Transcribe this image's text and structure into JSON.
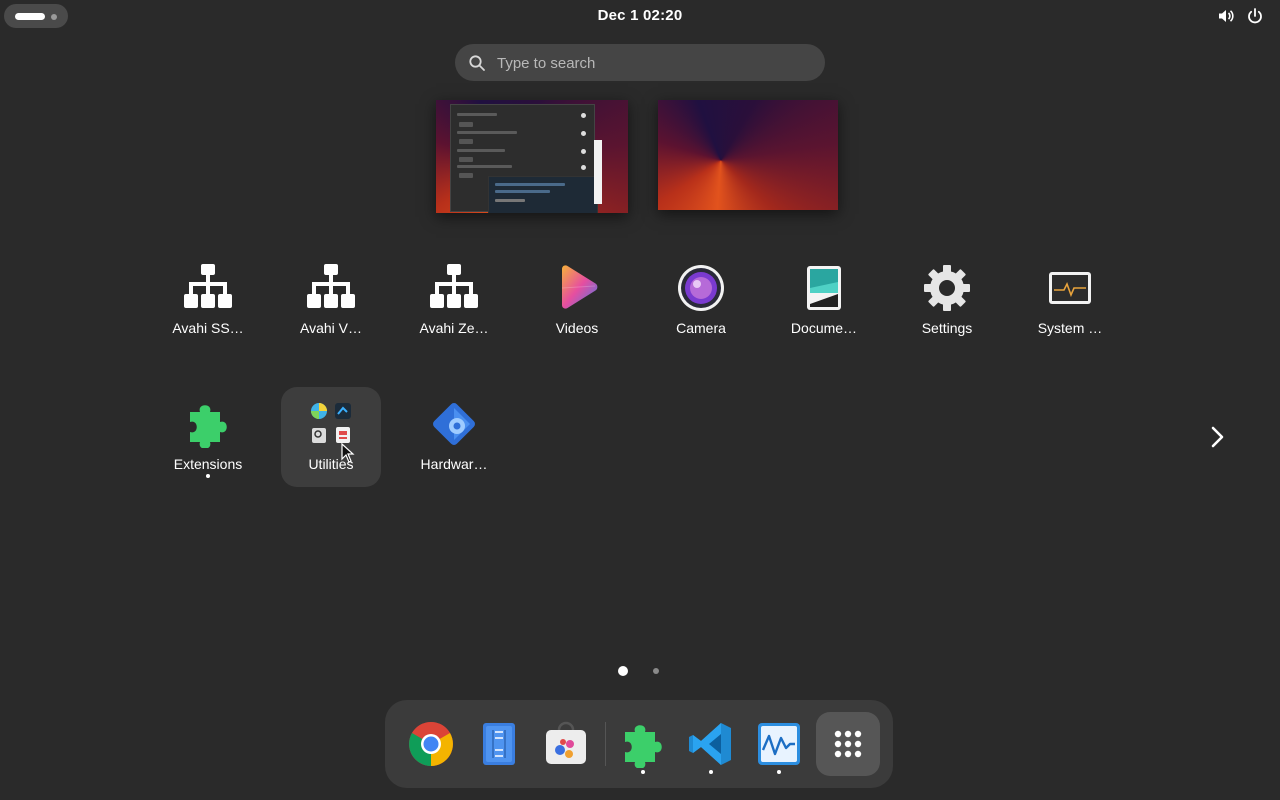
{
  "topbar": {
    "clock": "Dec 1  02:20",
    "activities": "activities-indicator",
    "icons": [
      "volume-icon",
      "power-icon"
    ]
  },
  "search": {
    "placeholder": "Type to search"
  },
  "workspaces": [
    "workspace-1",
    "workspace-2"
  ],
  "apps": {
    "row1": [
      {
        "label": "Avahi SS…",
        "icon": "network-icon"
      },
      {
        "label": "Avahi V…",
        "icon": "network-icon"
      },
      {
        "label": "Avahi Ze…",
        "icon": "network-icon"
      },
      {
        "label": "Videos",
        "icon": "videos-icon"
      },
      {
        "label": "Camera",
        "icon": "camera-icon"
      },
      {
        "label": "Docume…",
        "icon": "document-scanner-icon"
      },
      {
        "label": "Settings",
        "icon": "settings-gear-icon"
      },
      {
        "label": "System …",
        "icon": "system-monitor-icon"
      }
    ],
    "row2": [
      {
        "label": "Extensions",
        "icon": "extensions-puzzle-icon",
        "running": true
      },
      {
        "label": "Utilities",
        "icon": "folder-grid-icon"
      },
      {
        "label": "Hardwar…",
        "icon": "hardware-gear-icon"
      }
    ]
  },
  "pages": {
    "current": 1,
    "total": 2
  },
  "dock": [
    {
      "name": "chrome",
      "icon": "chrome-icon",
      "running": false
    },
    {
      "name": "files",
      "icon": "text-editor-icon",
      "running": false
    },
    {
      "name": "software",
      "icon": "software-store-icon",
      "running": false
    },
    {
      "name": "extensions",
      "icon": "extensions-puzzle-icon",
      "running": true
    },
    {
      "name": "vscode",
      "icon": "vscode-icon",
      "running": true
    },
    {
      "name": "system-monitor",
      "icon": "system-monitor-icon",
      "running": true
    },
    {
      "name": "app-grid",
      "icon": "app-grid-icon",
      "running": false
    }
  ],
  "colors": {
    "background": "#2a2a2a",
    "dock": "#3b3b3b",
    "search": "#454545"
  }
}
